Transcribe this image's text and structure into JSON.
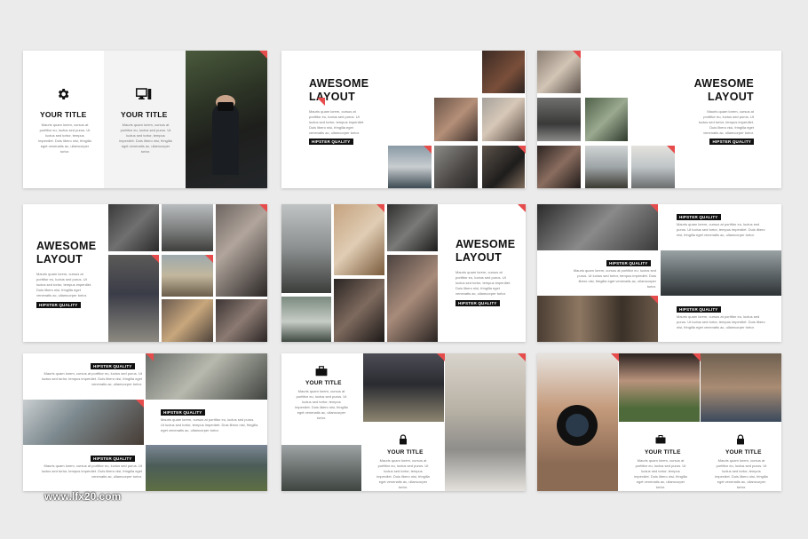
{
  "watermark": "www.lfx20.com",
  "awesome": [
    "AWESOME",
    "LAYOUT"
  ],
  "your_title": "YOUR TITLE",
  "badge": "HIPSTER QUALITY",
  "body_text": "Mauris quam lorem, cursus at porttitor eu, luctus sed purus. Ut luctus sed tortor, tempus imperdiet. Duis libero nisi, fringilla eget venenatis ac, ullamcorper tortor.",
  "icons": {
    "gear": "gear-icon",
    "monitor": "monitor-icon",
    "briefcase": "briefcase-icon",
    "lock": "lock-icon"
  },
  "colors": {
    "accent": "#e74c4c",
    "badge_bg": "#111111",
    "page_bg": "#ebebeb"
  }
}
